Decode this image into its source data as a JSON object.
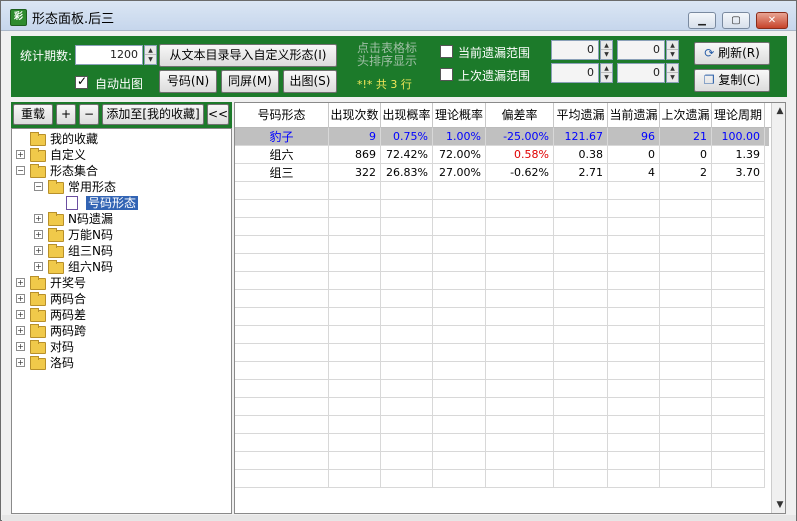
{
  "window": {
    "title": "形态面板.后三"
  },
  "titlebar": {
    "minimize_glyph": "▁",
    "maximize_glyph": "▢",
    "close_glyph": "✕"
  },
  "toolbar": {
    "periods_label": "统计期数:",
    "periods_value": "1200",
    "auto_chart_label": "自动出图",
    "auto_chart_checked": true,
    "import_button": "从文本目录导入自定义形态(I)",
    "number_button": "号码(N)",
    "same_screen_button": "同屏(M)",
    "chart_button": "出图(S)",
    "hint_line1": "点击表格标",
    "hint_line2": "头排序显示",
    "row_count": "*!* 共 3 行",
    "current_miss_label": "当前遗漏范围",
    "last_miss_label": "上次遗漏范围",
    "current_miss_from": "0",
    "current_miss_to": "0",
    "last_miss_from": "0",
    "last_miss_to": "0",
    "refresh_button": "刷新(R)",
    "copy_button": "复制(C)"
  },
  "left_toolbar": {
    "reload_button": "重载",
    "plus_button": "+",
    "minus_button": "−",
    "add_fav_button": "添加至[我的收藏]",
    "collapse_button": "<<"
  },
  "tree": [
    {
      "label": "我的收藏",
      "level": 0,
      "expander": "",
      "icon": "folder-icon"
    },
    {
      "label": "自定义",
      "level": 0,
      "expander": "+",
      "icon": "folder-icon"
    },
    {
      "label": "形态集合",
      "level": 0,
      "expander": "−",
      "icon": "folder-icon"
    },
    {
      "label": "常用形态",
      "level": 1,
      "expander": "−",
      "icon": "folder-icon"
    },
    {
      "label": "号码形态",
      "level": 2,
      "expander": "",
      "icon": "document-icon",
      "selected": true
    },
    {
      "label": "N码遗漏",
      "level": 1,
      "expander": "+",
      "icon": "folder-icon"
    },
    {
      "label": "万能N码",
      "level": 1,
      "expander": "+",
      "icon": "folder-icon"
    },
    {
      "label": "组三N码",
      "level": 1,
      "expander": "+",
      "icon": "folder-icon"
    },
    {
      "label": "组六N码",
      "level": 1,
      "expander": "+",
      "icon": "folder-icon"
    },
    {
      "label": "开奖号",
      "level": 0,
      "expander": "+",
      "icon": "folder-icon"
    },
    {
      "label": "两码合",
      "level": 0,
      "expander": "+",
      "icon": "folder-icon"
    },
    {
      "label": "两码差",
      "level": 0,
      "expander": "+",
      "icon": "folder-icon"
    },
    {
      "label": "两码跨",
      "level": 0,
      "expander": "+",
      "icon": "folder-icon"
    },
    {
      "label": "对码",
      "level": 0,
      "expander": "+",
      "icon": "folder-icon"
    },
    {
      "label": "洛码",
      "level": 0,
      "expander": "+",
      "icon": "folder-icon"
    }
  ],
  "table": {
    "columns": [
      "号码形态",
      "出现次数",
      "出现概率",
      "理论概率",
      "偏差率",
      "平均遗漏",
      "当前遗漏",
      "上次遗漏",
      "理论周期"
    ],
    "rows": [
      {
        "cells": [
          "豹子",
          "9",
          "0.75%",
          "1.00%",
          "-25.00%",
          "121.67",
          "96",
          "21",
          "100.00"
        ],
        "highlight": true
      },
      {
        "cells": [
          "组六",
          "869",
          "72.42%",
          "72.00%",
          "0.58%",
          "0.38",
          "0",
          "0",
          "1.39"
        ],
        "highlight": false
      },
      {
        "cells": [
          "组三",
          "322",
          "26.83%",
          "27.00%",
          "-0.62%",
          "2.71",
          "4",
          "2",
          "3.70"
        ],
        "highlight": false
      }
    ],
    "empty_rows": 17
  },
  "colors": {
    "accent_green": "#1c7a2a",
    "highlight_row": "#c0c0c0",
    "blue_text": "#0000ff",
    "red_text": "#e00000"
  }
}
